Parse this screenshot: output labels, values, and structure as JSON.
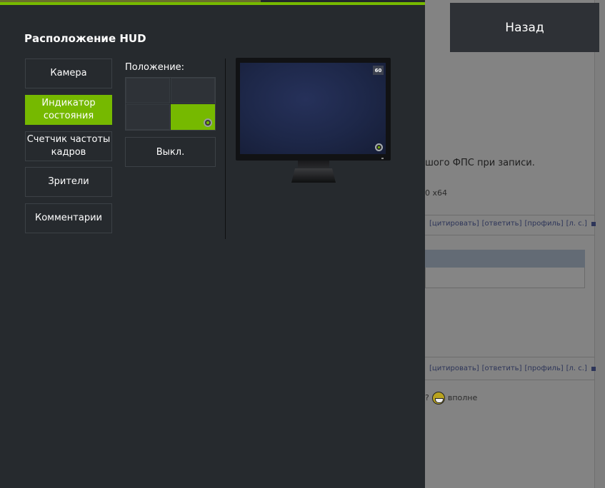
{
  "hud": {
    "title": "Расположение HUD",
    "menu": [
      {
        "label": "Камера",
        "active": false
      },
      {
        "label": "Индикатор состояния",
        "active": true
      },
      {
        "label": "Счетчик частоты кадров",
        "active": false
      },
      {
        "label": "Зрители",
        "active": false
      },
      {
        "label": "Комментарии",
        "active": false
      }
    ],
    "position_label": "Положение:",
    "position_grid": {
      "cells": [
        "top-left",
        "top-right",
        "bottom-left",
        "bottom-right"
      ],
      "selected": "bottom-right"
    },
    "off_button": "Выкл.",
    "preview": {
      "fps_value": "60"
    }
  },
  "back_button": "Назад",
  "background": {
    "text_line1": "шого ФПС при записи.",
    "text_line2": "0 x64",
    "actions": [
      "[цитировать]",
      "[ответить]",
      "[профиль]",
      "[л. с.]"
    ],
    "reply_text_prefix": "?",
    "reply_text": "вполне"
  },
  "colors": {
    "accent": "#76b900",
    "panel_bg": "#262a2e",
    "button_border": "#3c4146",
    "back_button_bg": "#2e3136"
  }
}
